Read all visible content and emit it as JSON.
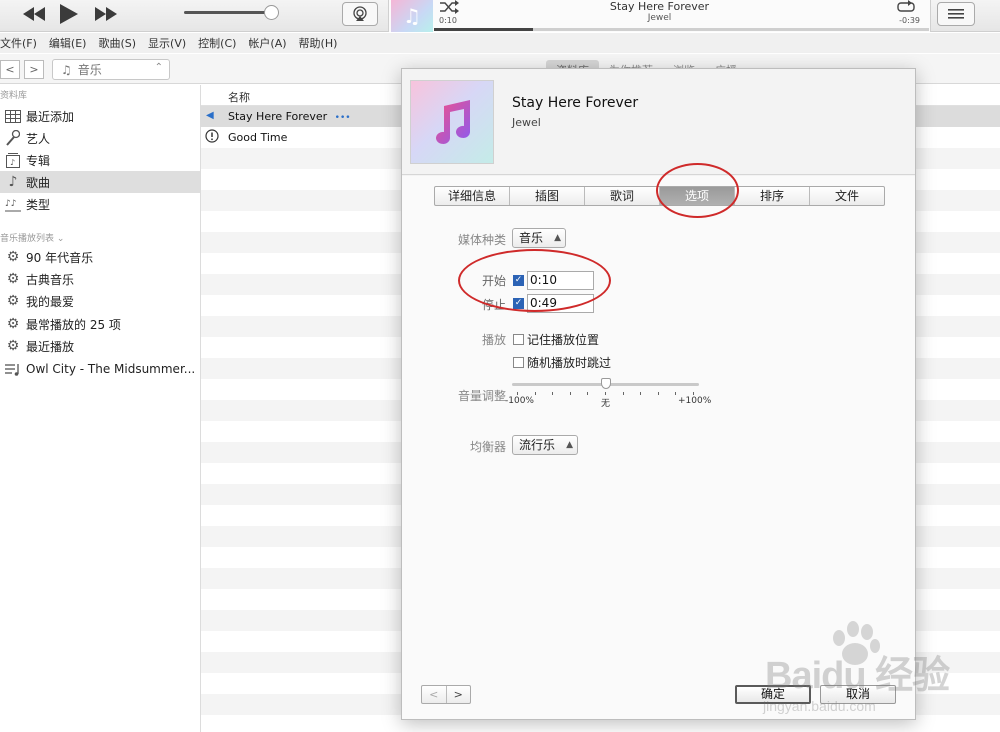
{
  "player": {
    "now_playing_title": "Stay Here Forever",
    "now_playing_artist": "Jewel",
    "elapsed": "0:10",
    "remaining": "-0:39",
    "progress_fraction": 0.2
  },
  "menu": [
    "文件(F)",
    "编辑(E)",
    "歌曲(S)",
    "显示(V)",
    "控制(C)",
    "帐户(A)",
    "帮助(H)"
  ],
  "nav": {
    "media_select": "音乐",
    "top_tabs": [
      "资料库",
      "为你推荐",
      "浏览",
      "广播"
    ]
  },
  "sidebar": {
    "library_header": "资料库",
    "library_items": [
      "最近添加",
      "艺人",
      "专辑",
      "歌曲",
      "类型"
    ],
    "playlists_header": "音乐播放列表 ⌄",
    "playlists": [
      "90 年代音乐",
      "古典音乐",
      "我的最爱",
      "最常播放的 25 项",
      "最近播放",
      "Owl City - The Midsummer..."
    ]
  },
  "songlist": {
    "column_name": "名称",
    "rows": [
      {
        "name": "Stay Here Forever",
        "more": "•••"
      },
      {
        "name": "Good Time"
      }
    ]
  },
  "dialog": {
    "title": "Stay Here Forever",
    "artist": "Jewel",
    "tabs": [
      "详细信息",
      "插图",
      "歌词",
      "选项",
      "排序",
      "文件"
    ],
    "active_tab": "选项",
    "media_kind_label": "媒体种类",
    "media_kind_value": "音乐",
    "start_label": "开始",
    "start_value": "0:10",
    "stop_label": "停止",
    "stop_value": "0:49",
    "playback_label": "播放",
    "remember_position": "记住播放位置",
    "skip_when_shuffling": "随机播放时跳过",
    "volume_label": "音量调整",
    "volume_min": "-100%",
    "volume_mid": "无",
    "volume_max": "+100%",
    "volume_fraction": 0.5,
    "equalizer_label": "均衡器",
    "equalizer_value": "流行乐",
    "ok_label": "确定",
    "cancel_label": "取消"
  },
  "watermark": {
    "main": "Baidu 经验",
    "sub": "jingyan.baidu.com"
  },
  "colors": {
    "annotation": "#cf2a2a",
    "selection": "#dcdcdc",
    "check": "#2c63b5"
  }
}
